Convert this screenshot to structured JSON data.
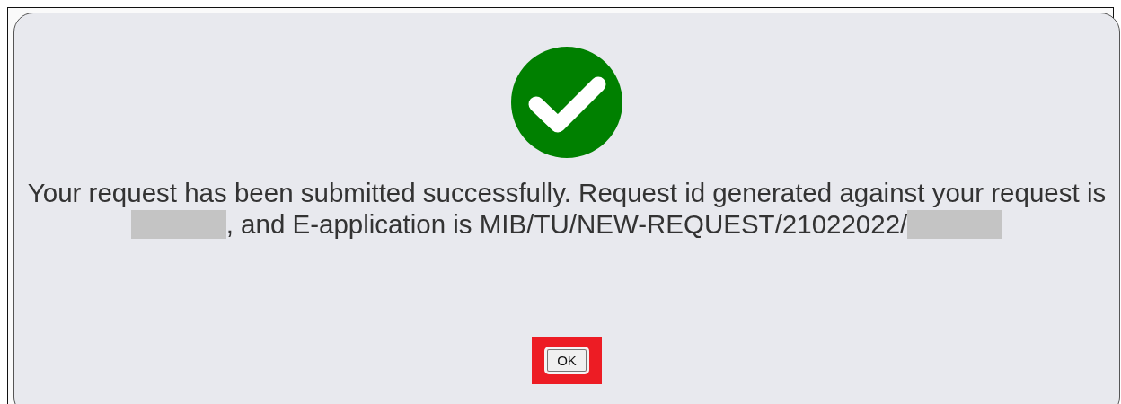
{
  "dialog": {
    "message_lines": [
      [
        {
          "kind": "text",
          "text": "Your request has been submitted successfully. Request id generated against your request is"
        }
      ],
      [
        {
          "kind": "redacted"
        },
        {
          "kind": "text",
          "text": ", and E-application is MIB/TU/NEW-REQUEST/21022022/"
        },
        {
          "kind": "redacted"
        }
      ]
    ],
    "button": {
      "label": "OK",
      "highlighted": true
    }
  }
}
